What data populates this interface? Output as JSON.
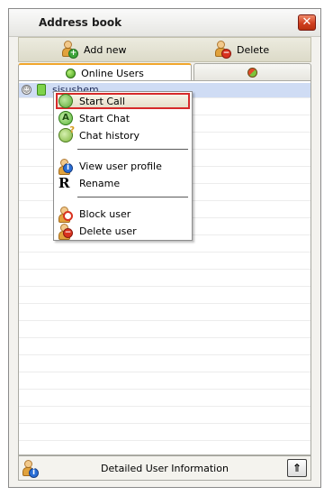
{
  "window": {
    "title": "Address book",
    "close_glyph": "✕"
  },
  "toolbar": {
    "add_label": "Add new",
    "add_icon": "user-add-icon",
    "delete_label": "Delete",
    "delete_icon": "user-delete-icon"
  },
  "tabs": [
    {
      "label": "Online Users",
      "icon": "status-online-icon",
      "active": true
    },
    {
      "label": "",
      "icon": "status-mixed-icon",
      "active": false
    }
  ],
  "users": [
    {
      "name": "sisushem",
      "selected": true
    }
  ],
  "context_menu": {
    "items": [
      {
        "label": "Start Call",
        "icon": "call-icon",
        "highlighted": true
      },
      {
        "label": "Start Chat",
        "icon": "chat-icon"
      },
      {
        "label": "Chat history",
        "icon": "chat-history-icon"
      },
      {
        "label": "View user profile",
        "icon": "user-info-icon"
      },
      {
        "label": "Rename",
        "icon": "rename-icon",
        "icon_glyph": "R"
      },
      {
        "label": "Block user",
        "icon": "user-block-icon"
      },
      {
        "label": "Delete user",
        "icon": "user-delete-icon"
      }
    ]
  },
  "bottom": {
    "label": "Detailed User Information",
    "expand_glyph": "⇑",
    "icon": "user-info-icon"
  },
  "colors": {
    "highlight_border": "#d62a2a",
    "selected_row": "#cfdcf4",
    "active_tab_accent": "#f0a52c"
  }
}
